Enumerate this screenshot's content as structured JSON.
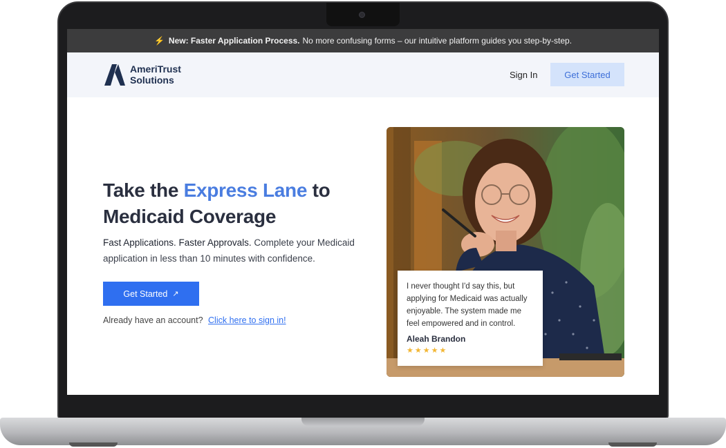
{
  "announcement": {
    "icon": "lightning-icon",
    "bold": "New: Faster Application Process.",
    "text": "No more confusing forms – our intuitive platform guides you step-by-step."
  },
  "nav": {
    "logo_line1": "AmeriTrust",
    "logo_line2": "Solutions",
    "signin_label": "Sign In",
    "cta_label": "Get Started"
  },
  "hero": {
    "headline_start": "Take the ",
    "headline_accent": "Express Lane",
    "headline_mid": " to",
    "headline_end": "Medicaid Coverage",
    "sub_bold": "Fast Applications. Faster Approvals.",
    "sub_text": " Complete your Medicaid application in less than 10 minutes with confidence.",
    "cta_label": "Get Started",
    "cta_icon": "arrow-up-right-icon",
    "account_text": "Already have an account?",
    "signin_link": "Click here to sign in!"
  },
  "testimonial": {
    "quote": "I never thought I'd say this, but applying for Medicaid was actually enjoyable. The system made me feel empowered and in control.",
    "author": "Aleah Brandon",
    "stars": "★★★★★",
    "rating": 5
  },
  "colors": {
    "accent": "#4a7de0",
    "primary_button": "#2f6ff0",
    "announce_bg": "#3c3c3d",
    "nav_bg": "#f3f5fa",
    "logo_navy": "#1f3050",
    "star": "#f2b634"
  }
}
